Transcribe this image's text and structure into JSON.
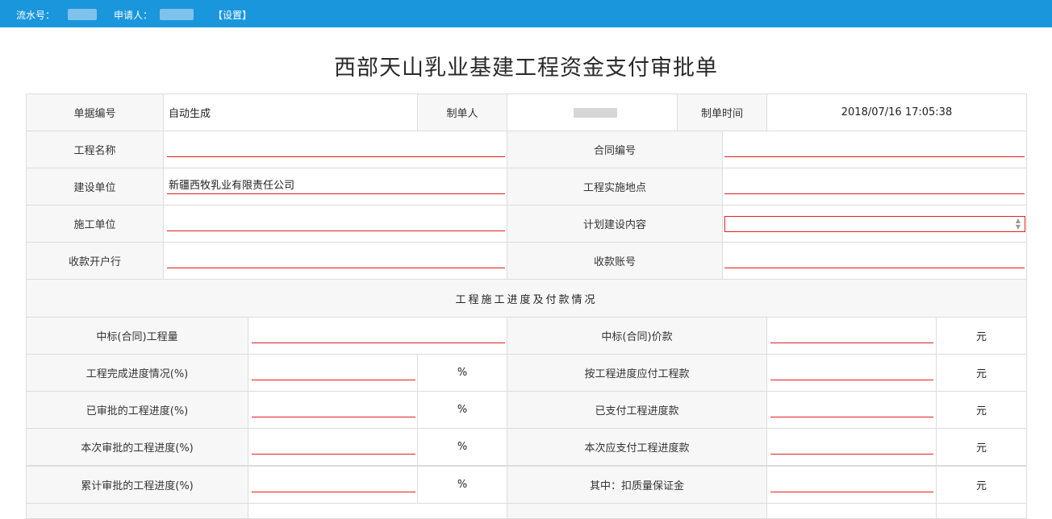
{
  "topbar": {
    "serial_label": "流水号：",
    "applicant_label": "申请人：",
    "settings_link": "【设置】"
  },
  "title": "西部天山乳业基建工程资金支付审批单",
  "form": {
    "doc_no_label": "单据编号",
    "doc_no_value": "自动生成",
    "creator_label": "制单人",
    "created_time_label": "制单时间",
    "created_time_value": "2018/07/16 17:05:38",
    "project_name_label": "工程名称",
    "contract_no_label": "合同编号",
    "builder_unit_label": "建设单位",
    "builder_unit_value": "新疆西牧乳业有限责任公司",
    "site_label": "工程实施地点",
    "construction_unit_label": "施工单位",
    "plan_content_label": "计划建设内容",
    "payee_bank_label": "收款开户行",
    "payee_account_label": "收款账号"
  },
  "progress": {
    "section_title": "工程施工进度及付款情况",
    "rows": [
      {
        "left_label": "中标(合同)工程量",
        "unit_left": "",
        "right_label": "中标(合同)价款",
        "unit_right": "元"
      },
      {
        "left_label": "工程完成进度情况(%)",
        "unit_left": "%",
        "right_label": "按工程进度应付工程款",
        "unit_right": "元"
      },
      {
        "left_label": "已审批的工程进度(%)",
        "unit_left": "%",
        "right_label": "已支付工程进度款",
        "unit_right": "元"
      },
      {
        "left_label": "本次审批的工程进度(%)",
        "unit_left": "%",
        "right_label": "本次应支付工程进度款",
        "unit_right": "元"
      },
      {
        "left_label": "累计审批的工程进度(%)",
        "unit_left": "%",
        "right_label": "其中：扣质量保证金",
        "unit_right": "元"
      }
    ]
  },
  "colors": {
    "topbar": "#1a96dc",
    "required_underline": "#e02020",
    "label_bg": "#f7f7f7",
    "border": "#dcdcdc"
  }
}
